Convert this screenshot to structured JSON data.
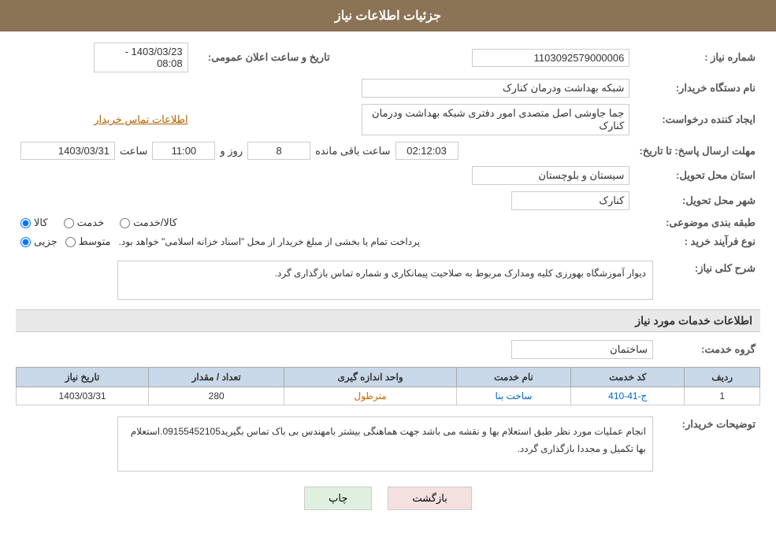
{
  "header": {
    "title": "جزئیات اطلاعات نیاز"
  },
  "fields": {
    "need_number_label": "شماره نیاز :",
    "need_number_value": "1103092579000006",
    "buyer_org_label": "نام دستگاه خریدار:",
    "buyer_org_value": "شبکه بهداشت ودرمان کنارک",
    "requester_label": "ایجاد کننده درخواست:",
    "requester_value": "جما جاوشی اصل متصدی امور دفتری شبکه بهداشت ودرمان کنارک",
    "requester_link": "اطلاعات تماس خریدار",
    "response_deadline_label": "مهلت ارسال پاسخ: تا تاریخ:",
    "deadline_date": "1403/03/31",
    "deadline_time_label": "ساعت",
    "deadline_time": "11:00",
    "deadline_day_label": "روز و",
    "deadline_days": "8",
    "remaining_label": "ساعت باقی مانده",
    "remaining_time": "02:12:03",
    "province_label": "استان محل تحویل:",
    "province_value": "سیستان و بلوچستان",
    "city_label": "شهر محل تحویل:",
    "city_value": "کنارک",
    "category_label": "طبقه بندی موضوعی:",
    "category_kala": "کالا",
    "category_khedmat": "خدمت",
    "category_kala_khedmat": "کالا/خدمت",
    "purchase_type_label": "نوع فرآیند خرید :",
    "purchase_jozei": "جزیی",
    "purchase_mottasat": "متوسط",
    "purchase_text": "پرداخت تمام یا بخشی از مبلغ خریدار از محل \"اسناد خزانه اسلامی\" خواهد بود.",
    "announce_date_label": "تاریخ و ساعت اعلان عمومی:",
    "announce_date_value": "1403/03/23 - 08:08",
    "description_section_label": "شرح کلی نیاز:",
    "description_value": "دیوار آموزشگاه بهورزی کلیه ومدارک مربوط به صلاحیت پیمانکاری و شماره تماس بازگذاری گرد.",
    "services_section_label": "اطلاعات خدمات مورد نیاز",
    "service_group_label": "گروه خدمت:",
    "service_group_value": "ساختمان",
    "table_headers": [
      "ردیف",
      "کد خدمت",
      "نام خدمت",
      "واحد اندازه گیری",
      "تعداد / مقدار",
      "تاریخ نیاز"
    ],
    "table_rows": [
      {
        "row": "1",
        "code": "ج-41-410",
        "name": "ساخت بنا",
        "unit": "مترطول",
        "quantity": "280",
        "date": "1403/03/31"
      }
    ],
    "buyer_notes_label": "توضیحات خریدار:",
    "buyer_notes_value": "انجام عملیات مورد نظر طبق استعلام بها و نقشه می باشد جهت هماهنگی بیشتر بامهندس بی باک تماس بگیرید09155452105.استعلام بها تکمیل و مجددا بازگذاری گردد.",
    "btn_back": "بازگشت",
    "btn_print": "چاپ"
  }
}
